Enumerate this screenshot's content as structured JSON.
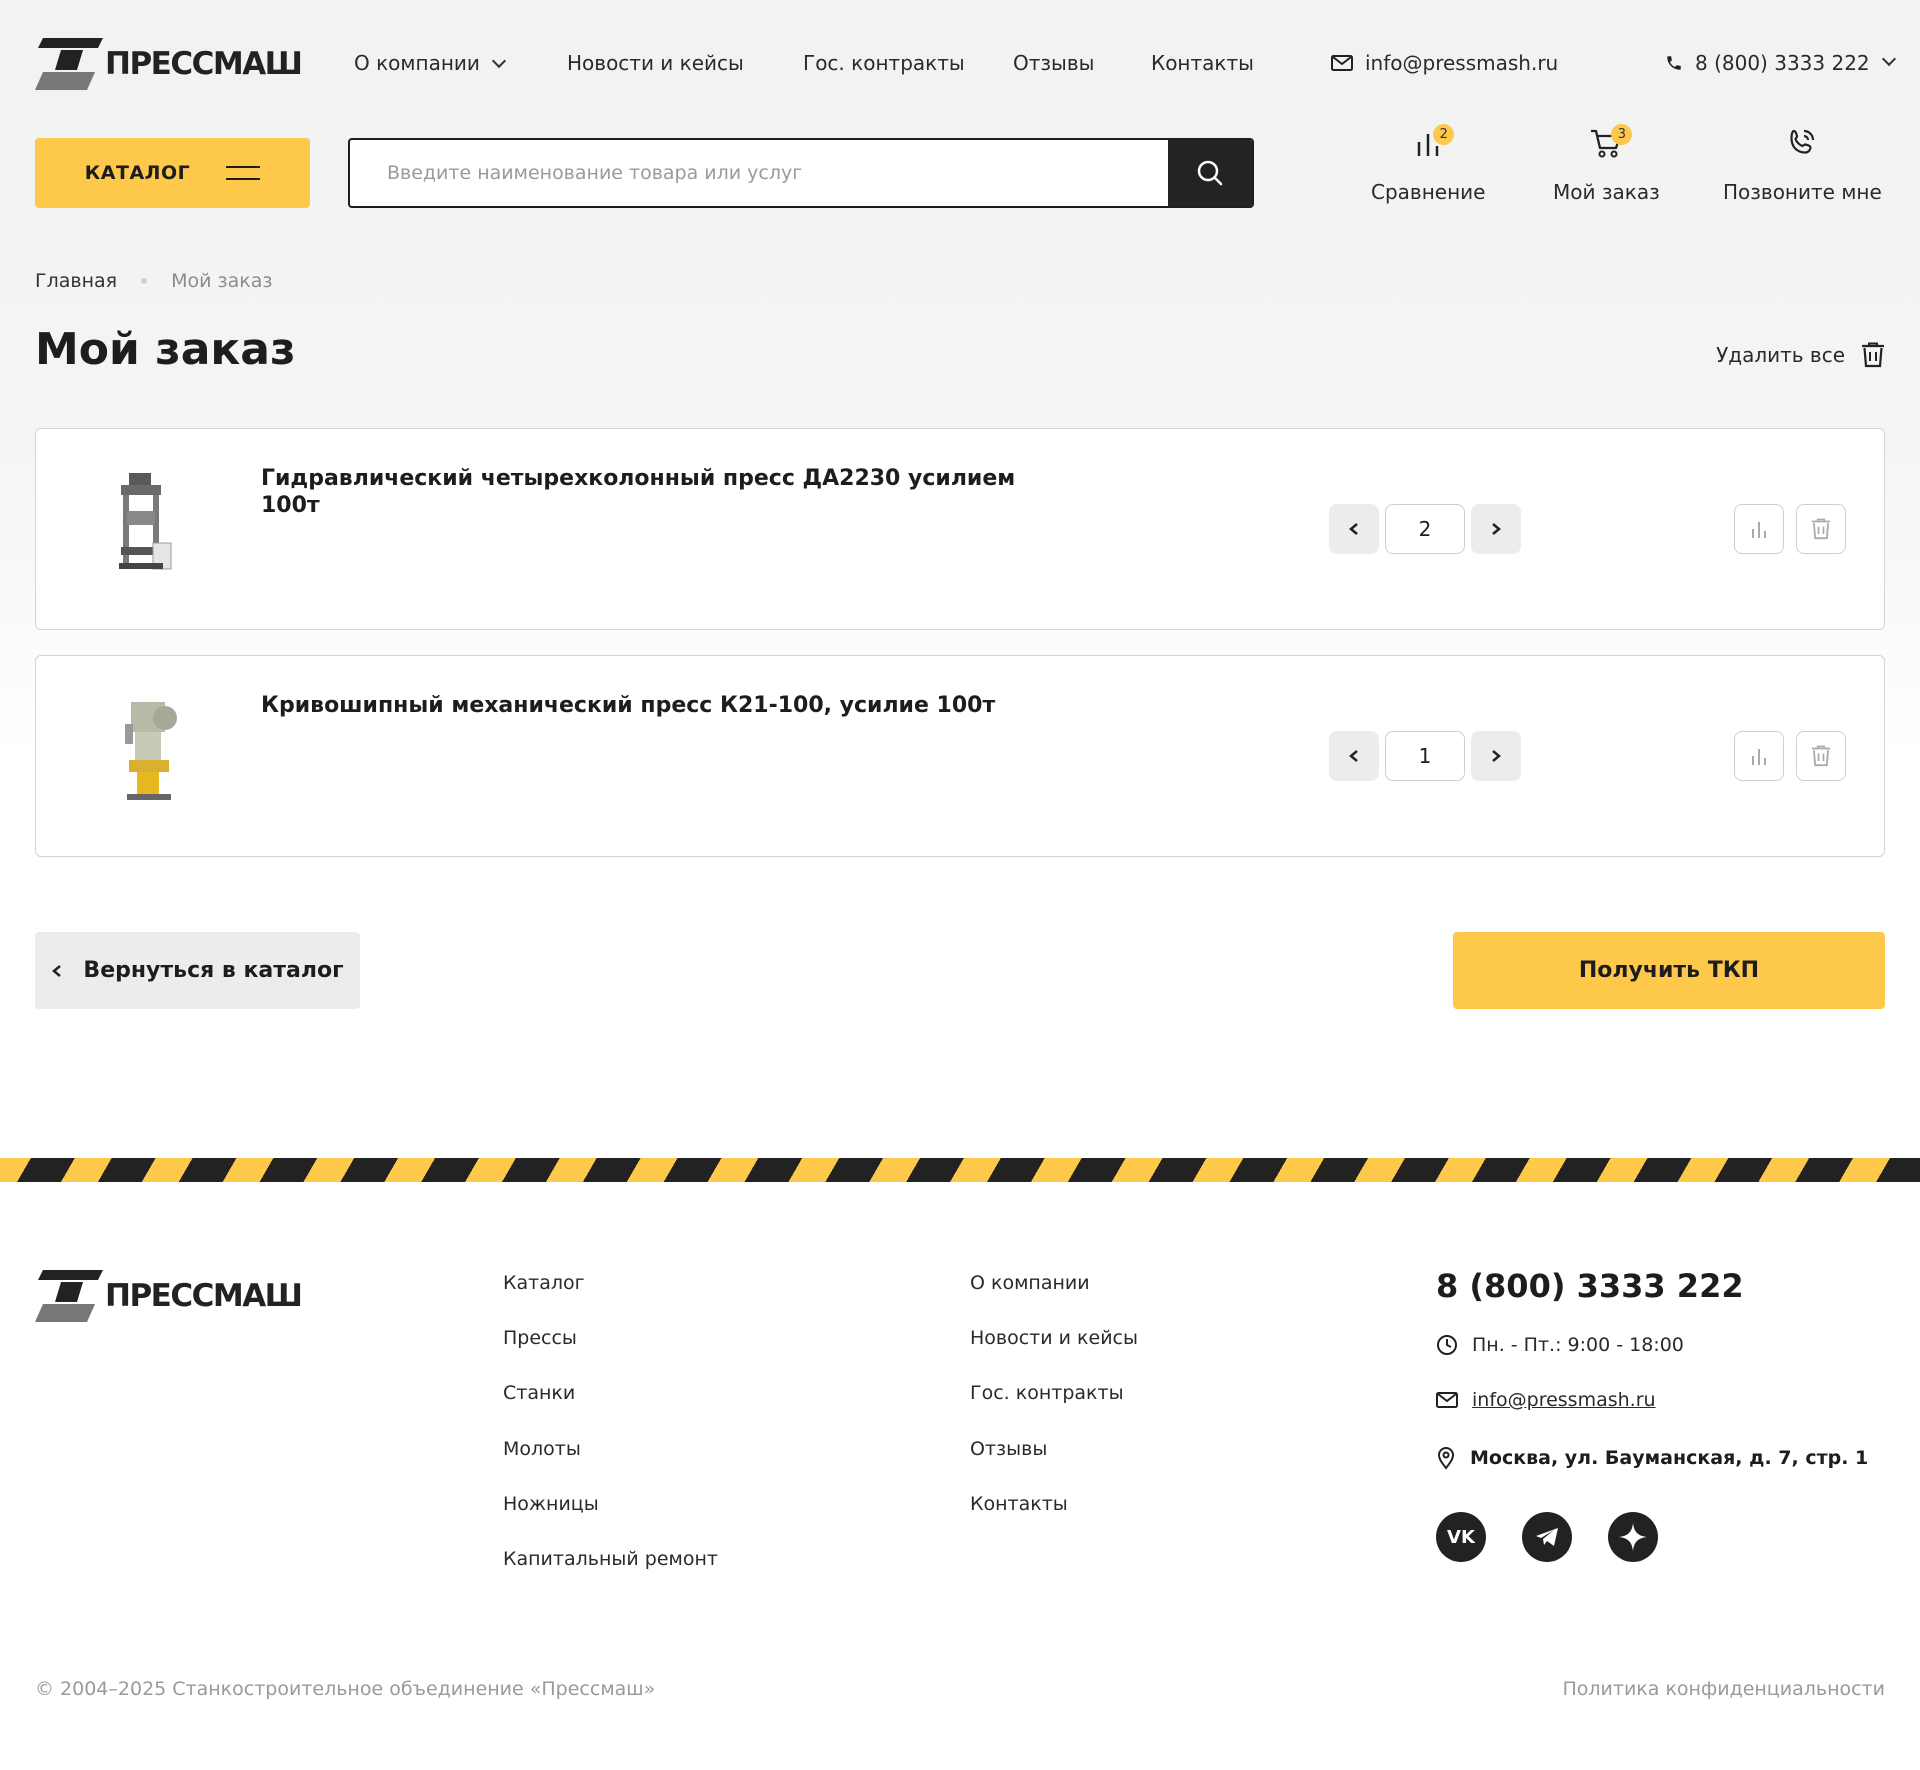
{
  "header": {
    "logo": "ПРЕССМАШ",
    "nav": [
      "О компании",
      "Новости и кейсы",
      "Гос. контракты",
      "Отзывы",
      "Контакты"
    ],
    "email": "info@pressmash.ru",
    "phone": "8 (800) 3333 222"
  },
  "toolbar": {
    "catalog_label": "КАТАЛОГ",
    "search_placeholder": "Введите наименование товара или услуг",
    "tools": [
      {
        "label": "Сравнение",
        "badge": "2",
        "icon": "compare-icon"
      },
      {
        "label": "Мой заказ",
        "badge": "3",
        "icon": "cart-icon"
      },
      {
        "label": "Позвоните мне",
        "icon": "phone-call-icon"
      }
    ]
  },
  "breadcrumb": {
    "home": "Главная",
    "current": "Мой заказ"
  },
  "page_title": "Мой заказ",
  "delete_all_label": "Удалить все",
  "cart": {
    "items": [
      {
        "name": "Гидравлический четырехколонный пресс ДА2230 усилием 100т",
        "quantity": "2"
      },
      {
        "name": "Кривошипный механический пресс К21-100, усилие 100т",
        "quantity": "1"
      }
    ]
  },
  "actions": {
    "back_label": "Вернуться в каталог",
    "tkp_label": "Получить ТКП"
  },
  "footer": {
    "col1": [
      "Каталог",
      "Прессы",
      "Станки",
      "Молоты",
      "Ножницы",
      "Капитальный ремонт"
    ],
    "col2": [
      "О компании",
      "Новости и кейсы",
      "Гос. контракты",
      "Отзывы",
      "Контакты"
    ],
    "phone": "8 (800) 3333 222",
    "hours": "Пн. - Пт.: 9:00 - 18:00",
    "email": "info@pressmash.ru",
    "address": "Москва, ул. Бауманская, д. 7, стр. 1",
    "socials": [
      "vk-icon",
      "telegram-icon",
      "star-icon"
    ],
    "copyright": "© 2004–2025 Станкостроительное объединение «Прессмаш»",
    "policy": "Политика конфиденциальности"
  },
  "colors": {
    "accent": "#fec94a",
    "dark": "#232323",
    "muted": "#9a9a9a"
  }
}
